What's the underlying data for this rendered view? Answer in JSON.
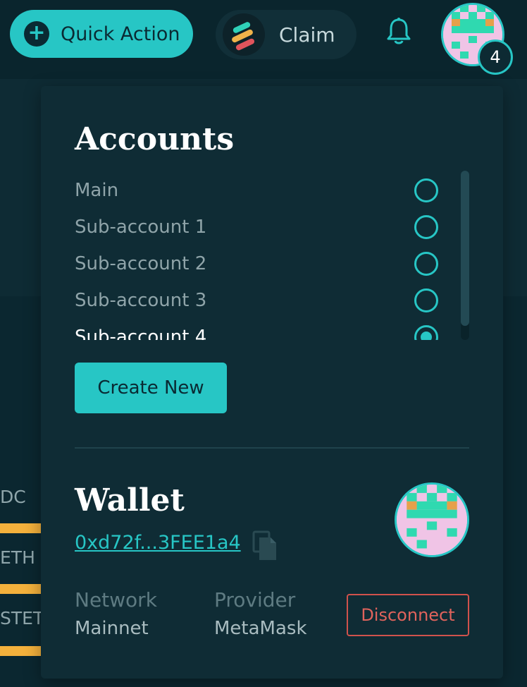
{
  "header": {
    "quick_action_label": "Quick Action",
    "claim_label": "Claim",
    "notification_count": "4"
  },
  "background_assets": [
    "DC",
    "ETH",
    "STETH"
  ],
  "accounts": {
    "title": "Accounts",
    "items": [
      {
        "label": "Main",
        "selected": false
      },
      {
        "label": "Sub-account 1",
        "selected": false
      },
      {
        "label": "Sub-account 2",
        "selected": false
      },
      {
        "label": "Sub-account 3",
        "selected": false
      },
      {
        "label": "Sub-account 4",
        "selected": true
      }
    ],
    "create_label": "Create New"
  },
  "wallet": {
    "title": "Wallet",
    "address": "0xd72f...3FEE1a4",
    "network_label": "Network",
    "network_value": "Mainnet",
    "provider_label": "Provider",
    "provider_value": "MetaMask",
    "disconnect_label": "Disconnect"
  },
  "colors": {
    "accent": "#27c6c5",
    "background": "#0d2a33",
    "panel": "#0f2c35",
    "danger": "#d0524c",
    "asset_bar": "#f4b13c"
  }
}
